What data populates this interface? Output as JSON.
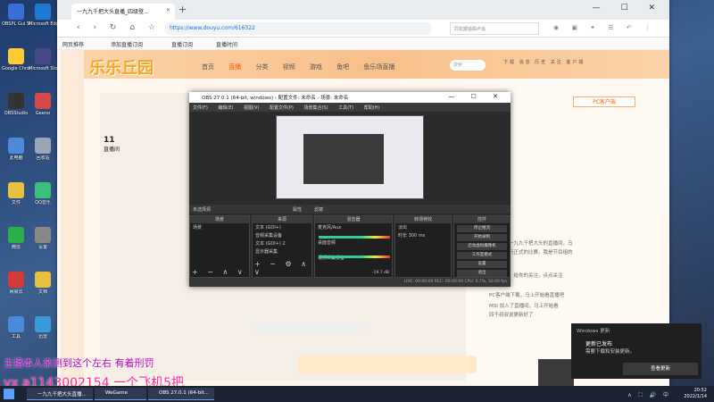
{
  "desktop": {
    "icons": [
      {
        "label": "OBSPL Gui Studio",
        "color": "#3a6fd8"
      },
      {
        "label": "Microsoft Edge",
        "color": "#1d7bd4"
      },
      {
        "label": "Google Chrome",
        "color": "#ffcc33"
      },
      {
        "label": "Microsoft Store",
        "color": "#4a4a8a"
      },
      {
        "label": "OBSStudio",
        "color": "#333333"
      },
      {
        "label": "Geeno",
        "color": "#d44a4a"
      },
      {
        "label": "此电脑",
        "color": "#4a8ad8"
      },
      {
        "label": "回收站",
        "color": "#9aa5b5"
      },
      {
        "label": "文件",
        "color": "#e8c040"
      },
      {
        "label": "QQ音乐",
        "color": "#3ac07a"
      },
      {
        "label": "微信",
        "color": "#2ab04a"
      },
      {
        "label": "设置",
        "color": "#888888"
      },
      {
        "label": "网易云",
        "color": "#d43a3a"
      },
      {
        "label": "文档",
        "color": "#e8c040"
      },
      {
        "label": "工具",
        "color": "#4a8ad8"
      },
      {
        "label": "迅雷",
        "color": "#3a9ad8"
      }
    ]
  },
  "browser": {
    "tab_title": "一九九千把大头直播_四级登...",
    "url": "https://www.douyu.com/616322",
    "search_placeholder": "同花顺追踪卢追",
    "favorites": [
      "网页推荐",
      "添加直播订阅",
      "直播订阅",
      "直播时间"
    ],
    "window_controls": "— ☐ ✕"
  },
  "site": {
    "banner": "乐乐丘园",
    "menu": [
      "首页",
      "直播",
      "分类",
      "视频",
      "游戏",
      "鱼吧",
      "鱼乐场直播"
    ],
    "menu_active": "直播",
    "search_placeholder": "搜索",
    "top_icons": "下载 消息 历史 关注 客户端",
    "room_number": "11",
    "room_label": "直播间",
    "chat": [
      "欢迎来到一九九千把大头的直播间，马",
      "上开始进行正式的比赛，我是节目组的",
      "支持主播，给你的关注，点点关注",
      "PC客户端下载，马上开始看直播吧",
      "四千叔叔说更新好了",
      "MSI 加入了直播间，马上开始看"
    ],
    "pc_label": "PC客户端"
  },
  "obs": {
    "title": "OBS 27.0.1 (64-bit, windows) - 配置文件: 未命名 - 场景: 未命名",
    "menu": [
      "文件(F)",
      "编辑(E)",
      "视图(V)",
      "配置文件(P)",
      "场景集合(S)",
      "工具(T)",
      "帮助(H)"
    ],
    "active_scene_label": "未选择源",
    "props_label": "属性",
    "filters_label": "滤镜",
    "docks": {
      "scenes": {
        "title": "场景",
        "items": [
          "场景"
        ]
      },
      "sources": {
        "title": "来源",
        "items": [
          "文本 (GDI+)",
          "音频采集设备",
          "文本 (GDI+) 2",
          "显示器采集"
        ]
      },
      "mixer": {
        "title": "混音器",
        "items": [
          "麦克风/Aux",
          "桌面音频",
          "视频采集设备"
        ],
        "levels": [
          "0.0 dB",
          "0.0 dB",
          "-19.7 dB"
        ]
      },
      "transitions": {
        "title": "转场特效",
        "type": "淡出",
        "duration_label": "时长",
        "duration": "300 ms"
      },
      "controls": {
        "title": "控件",
        "buttons": [
          "停止推流",
          "开始录制",
          "启动虚拟摄像机",
          "工作室模式",
          "设置",
          "退出"
        ]
      }
    },
    "status": "LIVE: 00:00:00   REC: 00:00:00   CPU: 0.7%, 30.00 fps"
  },
  "overlay": {
    "line1": "主播本人亲测到这个左右 有着刑罚",
    "line2": "vx a1143002154 一个飞机5把"
  },
  "notification": {
    "app": "Windows 更新",
    "title": "更新已发布",
    "body": "需要下载和安装更新。",
    "button": "查看更新"
  },
  "taskbar": {
    "items": [
      "一九九千把大头直播...",
      "WeGame",
      "OBS 27.0.1 (64-bit..."
    ],
    "clock_time": "20:52",
    "clock_date": "2022/1/14",
    "tray": "∧ ⛶ 🔊 中"
  }
}
